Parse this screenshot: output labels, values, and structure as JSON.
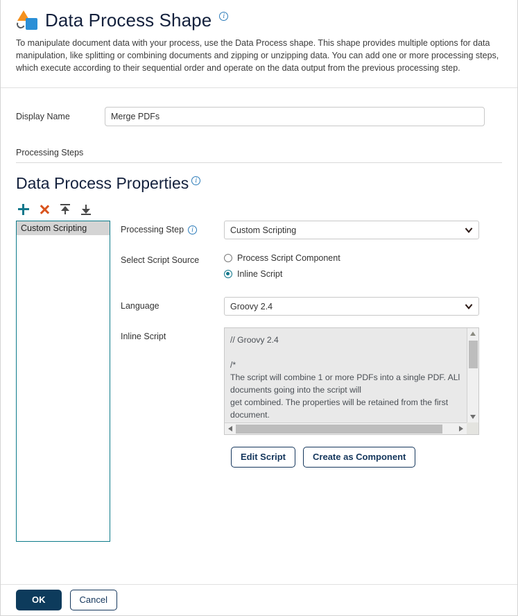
{
  "header": {
    "title": "Data Process Shape",
    "info_icon": "info-icon",
    "shape_icon": "data-process-shape-icon",
    "description": "To manipulate document data with your process, use the Data Process shape. This shape provides multiple options for data manipulation, like splitting or combining documents and zipping or unzipping data. You can add one or more processing steps, which execute according to their sequential order and operate on the data output from the previous processing step."
  },
  "display_name": {
    "label": "Display Name",
    "value": "Merge PDFs",
    "placeholder": ""
  },
  "processing_steps": {
    "section_label": "Processing Steps",
    "sub_title": "Data Process Properties",
    "toolbar": [
      {
        "name": "add-step-button",
        "glyph": "plus-icon",
        "color": "#12788c"
      },
      {
        "name": "delete-step-button",
        "glyph": "close-x-icon",
        "color": "#d9541e"
      },
      {
        "name": "move-step-up-button",
        "glyph": "arrow-up-to-line-icon",
        "color": "#4a4a4a"
      },
      {
        "name": "move-step-down-button",
        "glyph": "arrow-down-to-line-icon",
        "color": "#4a4a4a"
      }
    ],
    "step_list": [
      {
        "label": "Custom Scripting",
        "selected": true
      }
    ]
  },
  "form": {
    "processing_step": {
      "label": "Processing Step",
      "value": "Custom Scripting",
      "options": [
        "Custom Scripting"
      ]
    },
    "script_source": {
      "label": "Select Script Source",
      "options": [
        {
          "label": "Process Script Component",
          "selected": false
        },
        {
          "label": "Inline Script",
          "selected": true
        }
      ]
    },
    "language": {
      "label": "Language",
      "value": "Groovy 2.4",
      "options": [
        "Groovy 2.4"
      ]
    },
    "inline_script": {
      "label": "Inline Script",
      "value": "// Groovy 2.4\n\n/*\nThe script will combine 1 or more PDFs into a single PDF. ALl\ndocuments going into the script will\nget combined. The properties will be retained from the first\ndocument."
    },
    "actions": {
      "edit_script": "Edit Script",
      "create_as_component": "Create as Component"
    }
  },
  "footer": {
    "ok": "OK",
    "cancel": "Cancel"
  },
  "colors": {
    "primary": "#0d3b5c",
    "accent_teal": "#12788c",
    "accent_orange": "#d9541e",
    "icon_orange": "#f5911e",
    "icon_blue": "#2b8fd6",
    "title": "#14213d"
  }
}
